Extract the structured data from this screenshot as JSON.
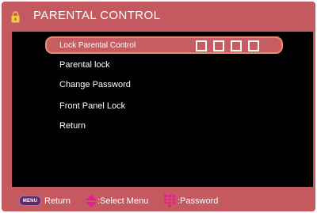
{
  "header": {
    "title": "PARENTAL CONTROL",
    "icon": "padlock-icon"
  },
  "menu": {
    "items": [
      {
        "label": "Lock Parental Control",
        "selected": true
      },
      {
        "label": "Parental lock",
        "selected": false
      },
      {
        "label": "Change Password",
        "selected": false
      },
      {
        "label": "Front Panel Lock",
        "selected": false
      },
      {
        "label": "Return",
        "selected": false
      }
    ],
    "password_boxes": 4
  },
  "footer": {
    "menu_badge": "MENU",
    "return_label": "Return",
    "select_label": ":Select Menu",
    "password_label": ":Password"
  },
  "colors": {
    "panel": "#c45a5f",
    "screen": "#000000",
    "highlight_border": "#ee8a6a",
    "icon_magenta": "#e0208f"
  }
}
